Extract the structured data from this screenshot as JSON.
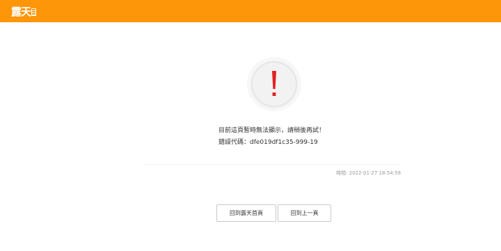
{
  "header": {
    "logo_text": "露天",
    "background_color": "#fe960a"
  },
  "alert": {
    "icon": "exclamation-icon",
    "color": "#e02020"
  },
  "message": {
    "line1": "目前這頁暫時無法顯示，請稍後再試！",
    "line2": "錯誤代碼：dfe019df1c35-999-19"
  },
  "timestamp": "時間: 2022-01-27 18:54:59",
  "buttons": {
    "home": "回到露天首頁",
    "back": "回到上一頁"
  }
}
